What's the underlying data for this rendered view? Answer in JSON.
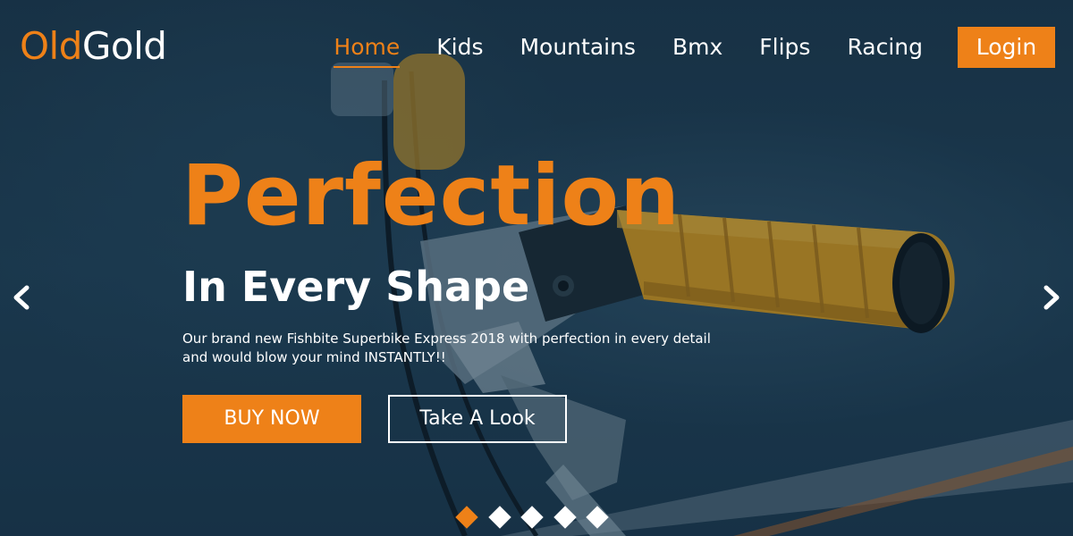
{
  "brand": {
    "part1": "Old",
    "part2": "Gold"
  },
  "nav": {
    "items": [
      {
        "label": "Home",
        "active": true
      },
      {
        "label": "Kids",
        "active": false
      },
      {
        "label": "Mountains",
        "active": false
      },
      {
        "label": "Bmx",
        "active": false
      },
      {
        "label": "Flips",
        "active": false
      },
      {
        "label": "Racing",
        "active": false
      }
    ],
    "login_label": "Login"
  },
  "hero": {
    "headline": "Perfection",
    "subheadline": "In Every Shape",
    "description_line1": "Our brand new Fishbite Superbike Express 2018 with perfection in every detail",
    "description_line2": "and would blow your mind INSTANTLY!!",
    "primary_button": "BUY NOW",
    "secondary_button": "Take A Look"
  },
  "carousel": {
    "slide_count": 5,
    "active_index": 0,
    "prev_icon": "chevron-left-icon",
    "next_icon": "chevron-right-icon"
  },
  "colors": {
    "accent": "#ee8118",
    "text": "#ffffff",
    "background": "#1e3d52"
  }
}
